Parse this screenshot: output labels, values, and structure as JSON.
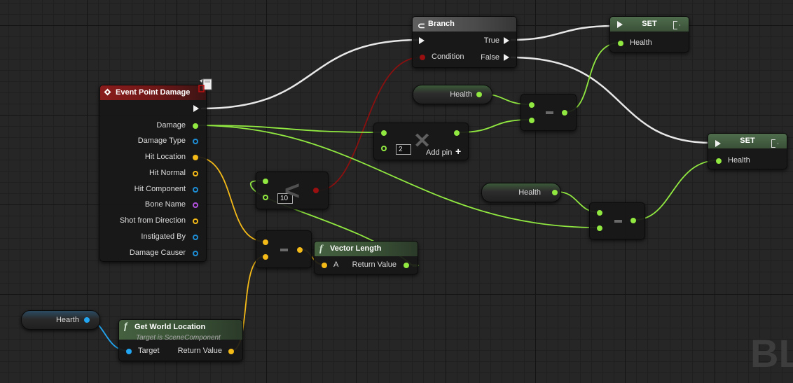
{
  "watermark": "BL",
  "nodes": {
    "event": {
      "title": "Event Point Damage",
      "pins": [
        "Damage",
        "Damage Type",
        "Hit Location",
        "Hit Normal",
        "Hit Component",
        "Bone Name",
        "Shot from Direction",
        "Instigated By",
        "Damage Causer"
      ]
    },
    "branch": {
      "title": "Branch",
      "condition": "Condition",
      "true_label": "True",
      "false_label": "False"
    },
    "set1": {
      "title": "SET",
      "pin": "Health"
    },
    "set2": {
      "title": "SET",
      "pin": "Health"
    },
    "health_var1": "Health",
    "health_var2": "Health",
    "hearth_var": "Hearth",
    "multiply": {
      "value": "2",
      "add_pin": "Add pin"
    },
    "less": {
      "value": "10"
    },
    "vector_length": {
      "title": "Vector Length",
      "input": "A",
      "output": "Return Value"
    },
    "get_world_location": {
      "title": "Get World Location",
      "subtitle": "Target is SceneComponent",
      "input": "Target",
      "output": "Return Value"
    }
  },
  "colors": {
    "exec": "#ffffff",
    "float": "#90e840",
    "vector": "#f4ba18",
    "object": "#22a6f2",
    "name": "#b452e0",
    "bool": "#9a1010"
  }
}
